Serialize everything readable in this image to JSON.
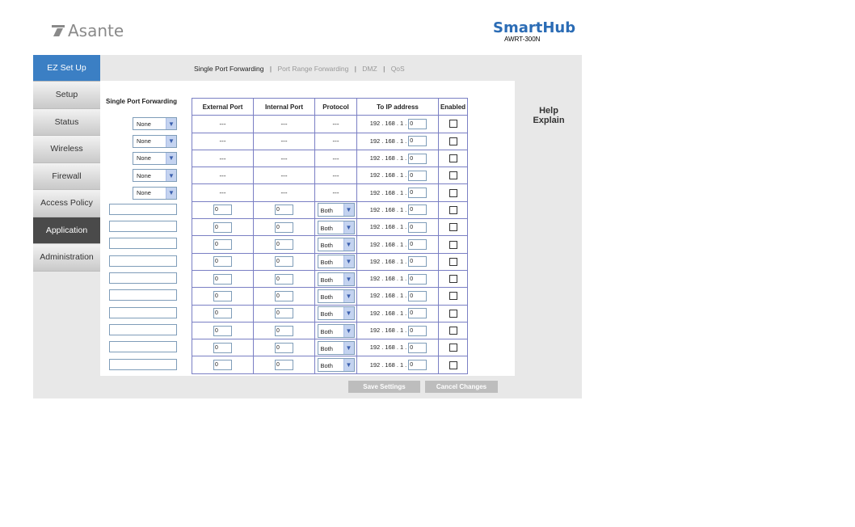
{
  "brand": {
    "left": "Asante",
    "right_title": "SmartHub",
    "right_model": "AWRT-300N"
  },
  "sidebar": {
    "items": [
      {
        "label": "EZ Set Up"
      },
      {
        "label": "Setup"
      },
      {
        "label": "Status"
      },
      {
        "label": "Wireless"
      },
      {
        "label": "Firewall"
      },
      {
        "label": "Access Policy"
      },
      {
        "label": "Application"
      },
      {
        "label": "Administration"
      }
    ],
    "active": "Application"
  },
  "topnav": {
    "items": [
      "Single Port Forwarding",
      "Port Range Forwarding",
      "DMZ",
      "QoS"
    ],
    "separator": "|"
  },
  "section": {
    "title": "Single Port Forwarding"
  },
  "table": {
    "headers": [
      "External Port",
      "Internal Port",
      "Protocol",
      "To IP address",
      "Enabled"
    ],
    "service_select_value": "None",
    "dash": "---",
    "protocol_value": "Both",
    "port_value": "0",
    "ip_prefix": [
      "192",
      "168",
      "1"
    ],
    "ip_last": "0"
  },
  "buttons": {
    "save": "Save Settings",
    "cancel": "Cancel Changes"
  },
  "help": {
    "line1": "Help",
    "line2": "Explain"
  },
  "colors": {
    "accent": "#3b7fc4",
    "active_nav": "#4a4a4a",
    "table_border": "#7a7fc4",
    "brand_blue": "#2b6cb5"
  }
}
